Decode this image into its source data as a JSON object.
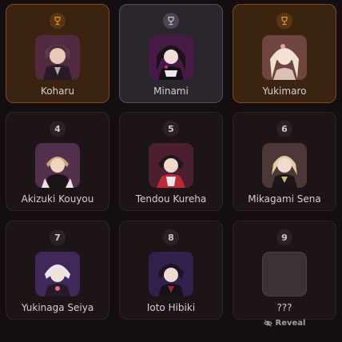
{
  "cards": [
    {
      "rank_icon": "trophy-gold-icon",
      "name": "Koharu"
    },
    {
      "rank_icon": "trophy-silver-icon",
      "name": "Minami"
    },
    {
      "rank_icon": "trophy-bronze-icon",
      "name": "Yukimaro"
    },
    {
      "rank": "4",
      "name": "Akizuki Kouyou"
    },
    {
      "rank": "5",
      "name": "Tendou Kureha"
    },
    {
      "rank": "6",
      "name": "Mikagami Sena"
    },
    {
      "rank": "7",
      "name": "Yukinaga Seiya"
    },
    {
      "rank": "8",
      "name": "Ioto Hibiki"
    },
    {
      "rank": "9",
      "name": "???",
      "hidden": true
    }
  ],
  "reveal_label": "Reveal",
  "colors": {
    "gold_accent": "#e39a2a",
    "silver_accent": "#c9c4cc",
    "bronze_accent": "#d99a45",
    "background": "#150e11"
  }
}
